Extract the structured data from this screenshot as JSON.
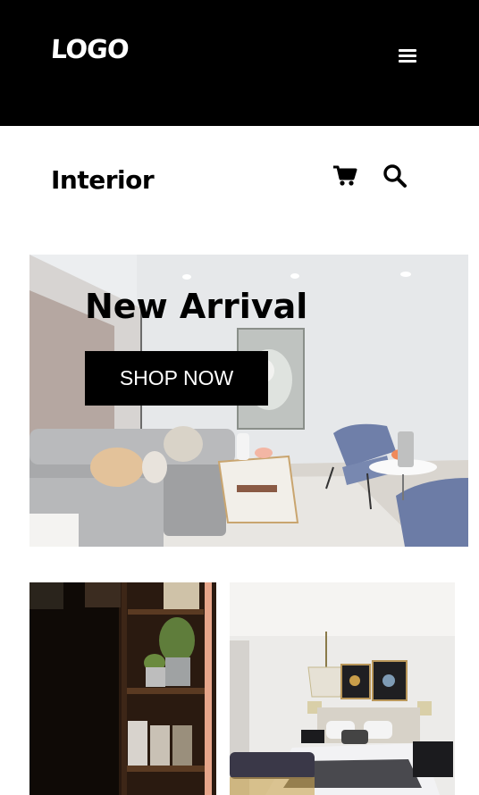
{
  "header": {
    "logo": "LOGO",
    "menu_icon": "hamburger-menu-icon"
  },
  "subheader": {
    "brand": "Interior",
    "cart_icon": "shopping-cart-icon",
    "search_icon": "search-icon"
  },
  "hero": {
    "title": "New Arrival",
    "cta_label": "SHOP NOW",
    "image": "living-room-photo"
  },
  "cards": [
    {
      "image": "kitchen-shelf-photo"
    },
    {
      "image": "bedroom-photo"
    }
  ],
  "colors": {
    "header_bg": "#000000",
    "page_bg": "#ffffff",
    "cta_bg": "#000000",
    "cta_text": "#ffffff"
  }
}
